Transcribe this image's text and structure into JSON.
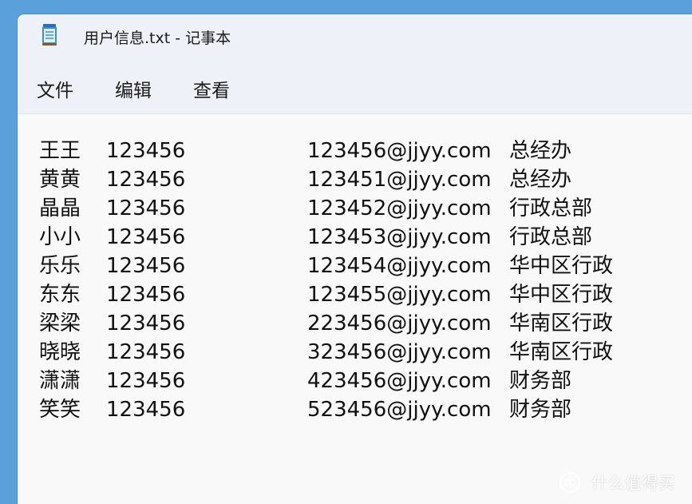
{
  "window": {
    "title": "用户信息.txt - 记事本",
    "app_icon": "notepad-icon"
  },
  "menu": {
    "items": [
      {
        "label": "文件"
      },
      {
        "label": "编辑"
      },
      {
        "label": "查看"
      }
    ]
  },
  "document": {
    "lines": [
      {
        "name": "王王",
        "password": "123456",
        "email": "123456@jjyy.com",
        "dept": "总经办"
      },
      {
        "name": "黄黄",
        "password": "123456",
        "email": "123451@jjyy.com",
        "dept": "总经办"
      },
      {
        "name": "晶晶",
        "password": "123456",
        "email": "123452@jjyy.com",
        "dept": "行政总部"
      },
      {
        "name": "小小",
        "password": "123456",
        "email": "123453@jjyy.com",
        "dept": "行政总部"
      },
      {
        "name": "乐乐",
        "password": "123456",
        "email": "123454@jjyy.com",
        "dept": "华中区行政"
      },
      {
        "name": "东东",
        "password": "123456",
        "email": "123455@jjyy.com",
        "dept": "华中区行政"
      },
      {
        "name": "梁梁",
        "password": "123456",
        "email": "223456@jjyy.com",
        "dept": "华南区行政"
      },
      {
        "name": "晓晓",
        "password": "123456",
        "email": "323456@jjyy.com",
        "dept": "华南区行政"
      },
      {
        "name": "潇潇",
        "password": "123456",
        "email": "423456@jjyy.com",
        "dept": "财务部"
      },
      {
        "name": "笑笑",
        "password": "123456",
        "email": "523456@jjyy.com",
        "dept": "财务部"
      }
    ]
  },
  "watermark": {
    "text": "什么值得买",
    "icon": "zhi-logo-icon"
  },
  "colors": {
    "desktop": "#5aa0da",
    "chrome": "#eef1f7",
    "editor_bg": "#f9f9f9",
    "text": "#111111"
  }
}
